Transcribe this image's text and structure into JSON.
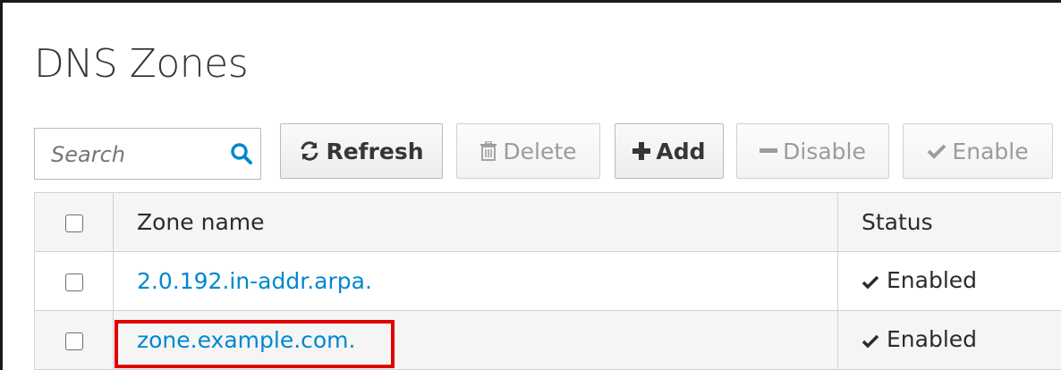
{
  "page": {
    "title": "DNS Zones"
  },
  "toolbar": {
    "search_placeholder": "Search",
    "search_icon": "search-icon",
    "buttons": {
      "refresh": {
        "label": "Refresh",
        "icon": "refresh-icon",
        "enabled": true
      },
      "delete": {
        "label": "Delete",
        "icon": "trash-icon",
        "enabled": false
      },
      "add": {
        "label": "Add",
        "icon": "plus-icon",
        "enabled": true
      },
      "disable": {
        "label": "Disable",
        "icon": "minus-icon",
        "enabled": false
      },
      "enable": {
        "label": "Enable",
        "icon": "check-icon",
        "enabled": false
      }
    }
  },
  "table": {
    "headers": {
      "zone_name": "Zone name",
      "status": "Status"
    },
    "rows": [
      {
        "zone_name": "2.0.192.in-addr.arpa.",
        "status": "Enabled",
        "highlighted": false
      },
      {
        "zone_name": "zone.example.com.",
        "status": "Enabled",
        "highlighted": true
      }
    ]
  },
  "colors": {
    "link": "#0088ce",
    "highlight": "#e00000",
    "search_icon": "#0088ce"
  }
}
